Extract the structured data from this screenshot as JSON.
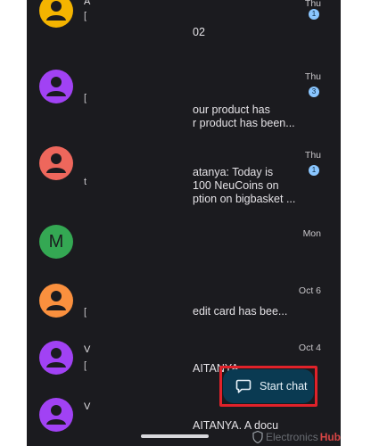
{
  "conversations": [
    {
      "id": "c1",
      "avatar_color": "#f4b400",
      "avatar_type": "person-icon",
      "name_fragment": "A",
      "preview_fragment": "[",
      "preview_lines": [
        "",
        "02"
      ],
      "date": "Thu",
      "unread_badge": "1"
    },
    {
      "id": "c2",
      "avatar_color": "#a142f4",
      "avatar_type": "person-icon",
      "name_fragment": "",
      "preview_fragment": "[",
      "preview_lines": [
        "our product has",
        "r product has been..."
      ],
      "date": "Thu",
      "unread_badge": "3"
    },
    {
      "id": "c3",
      "avatar_color": "#ee675c",
      "avatar_type": "person-icon",
      "name_fragment": "",
      "preview_fragment": "t",
      "preview_lines": [
        "atanya: Today is",
        "100 NeuCoins on",
        "ption on bigbasket ..."
      ],
      "date": "Thu",
      "unread_badge": "1"
    },
    {
      "id": "c4",
      "avatar_color": "#34a853",
      "avatar_type": "initial",
      "initial": "M",
      "name_fragment": "",
      "preview_fragment": "",
      "preview_lines": [],
      "date": "Mon",
      "unread_badge": ""
    },
    {
      "id": "c5",
      "avatar_color": "#fa903e",
      "avatar_type": "person-icon",
      "name_fragment": "",
      "preview_fragment": "[",
      "preview_lines": [
        "edit card has bee..."
      ],
      "date": "Oct 6",
      "unread_badge": ""
    },
    {
      "id": "c6",
      "avatar_color": "#a142f4",
      "avatar_type": "person-icon",
      "name_fragment": "V",
      "preview_fragment": "[",
      "preview_lines": [
        "AITANYA"
      ],
      "date": "Oct 4",
      "unread_badge": ""
    },
    {
      "id": "c7",
      "avatar_color": "#a142f4",
      "avatar_type": "person-icon",
      "name_fragment": "V",
      "preview_fragment": "",
      "preview_lines": [
        "AITANYA. A docu"
      ],
      "date": "",
      "unread_badge": ""
    }
  ],
  "fab": {
    "label": "Start chat",
    "icon": "chat-bubble-icon"
  },
  "watermark": {
    "text": "Electronics",
    "hub": "Hub"
  },
  "colors": {
    "background": "#1b1b1f",
    "fab": "#0a3a52",
    "highlight": "#e0222a",
    "badge": "#8ac6ff"
  }
}
